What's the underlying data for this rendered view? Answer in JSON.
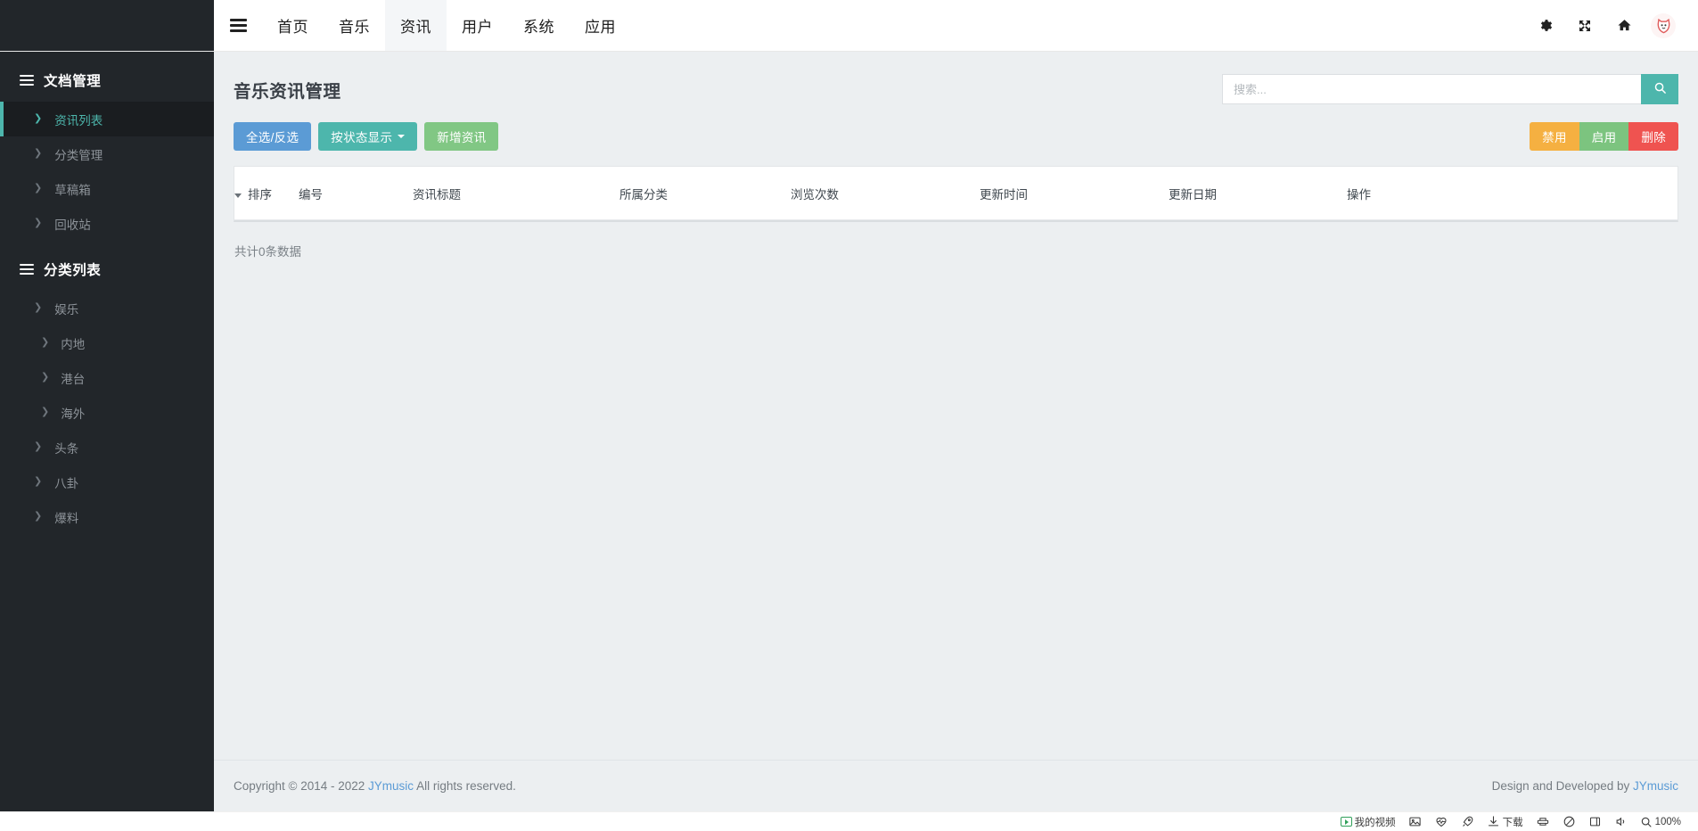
{
  "header": {
    "menu_icon": "hamburger-icon",
    "nav": [
      {
        "label": "首页",
        "active": false
      },
      {
        "label": "音乐",
        "active": false
      },
      {
        "label": "资讯",
        "active": true
      },
      {
        "label": "用户",
        "active": false
      },
      {
        "label": "系统",
        "active": false
      },
      {
        "label": "应用",
        "active": false
      }
    ],
    "icons": [
      {
        "name": "gear-icon"
      },
      {
        "name": "fullscreen-icon"
      },
      {
        "name": "home-icon"
      },
      {
        "name": "avatar-cat-icon"
      }
    ]
  },
  "sidebar": {
    "sections": [
      {
        "title": "文档管理",
        "icon": "list-icon",
        "items": [
          {
            "label": "资讯列表",
            "active": true,
            "sub": false
          },
          {
            "label": "分类管理",
            "active": false,
            "sub": false
          },
          {
            "label": "草稿箱",
            "active": false,
            "sub": false
          },
          {
            "label": "回收站",
            "active": false,
            "sub": false
          }
        ]
      },
      {
        "title": "分类列表",
        "icon": "list-icon",
        "items": [
          {
            "label": "娱乐",
            "active": false,
            "sub": false
          },
          {
            "label": "内地",
            "active": false,
            "sub": true
          },
          {
            "label": "港台",
            "active": false,
            "sub": true
          },
          {
            "label": "海外",
            "active": false,
            "sub": true
          },
          {
            "label": "头条",
            "active": false,
            "sub": false
          },
          {
            "label": "八卦",
            "active": false,
            "sub": false
          },
          {
            "label": "爆料",
            "active": false,
            "sub": false
          }
        ]
      }
    ]
  },
  "page": {
    "title": "音乐资讯管理"
  },
  "search": {
    "placeholder": "搜索...",
    "value": "",
    "button_icon": "search-icon"
  },
  "toolbar": {
    "select_all_label": "全选/反选",
    "filter_status_label": "按状态显示",
    "add_news_label": "新增资讯",
    "disable_label": "禁用",
    "enable_label": "启用",
    "delete_label": "删除"
  },
  "table": {
    "headers": [
      "排序",
      "编号",
      "资讯标题",
      "所属分类",
      "浏览次数",
      "更新时间",
      "更新日期",
      "操作"
    ],
    "rows": [],
    "total_text": "共计0条数据"
  },
  "footer": {
    "copyright_prefix": "Copyright © 2014 - 2022 ",
    "brand": "JYmusic",
    "copyright_suffix": " All rights reserved.",
    "design_prefix": "Design and Developed by ",
    "design_brand": "JYmusic"
  },
  "bottombar": {
    "items": [
      {
        "label": "我的视频",
        "icon": "video-icon"
      },
      {
        "label": "",
        "icon": "image-icon"
      },
      {
        "label": "",
        "icon": "heartbeat-icon"
      },
      {
        "label": "",
        "icon": "rocket-icon"
      },
      {
        "label": "下载",
        "icon": "download-icon"
      },
      {
        "label": "",
        "icon": "share-icon"
      },
      {
        "label": "",
        "icon": "shield-icon"
      },
      {
        "label": "",
        "icon": "window-icon"
      },
      {
        "label": "",
        "icon": "speaker-icon"
      },
      {
        "label": "100%",
        "icon": "zoom-icon"
      }
    ]
  },
  "colors": {
    "sidebar_bg": "#22262a",
    "accent_teal": "#4db6ac",
    "content_bg": "#eceff1",
    "primary_blue": "#5b9bd5",
    "success_green": "#81c784",
    "warning_orange": "#f5b041",
    "danger_red": "#ef5350",
    "link_blue": "#5b9bd5"
  }
}
